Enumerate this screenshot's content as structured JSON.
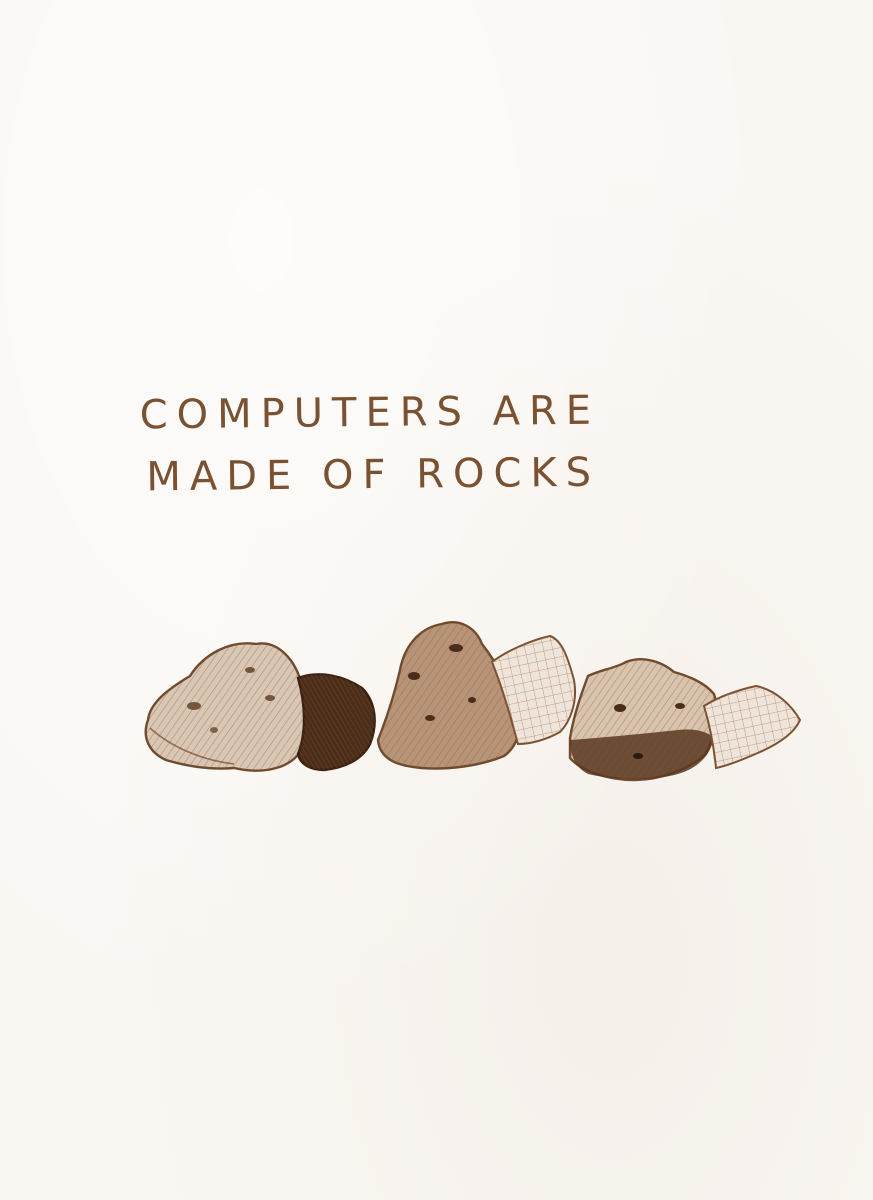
{
  "drawing": {
    "caption_line1": "COMPUTERS ARE",
    "caption_line2": "MADE OF ROCKS",
    "ink_color": "#7a5232",
    "paper_color": "#faf7f3"
  }
}
